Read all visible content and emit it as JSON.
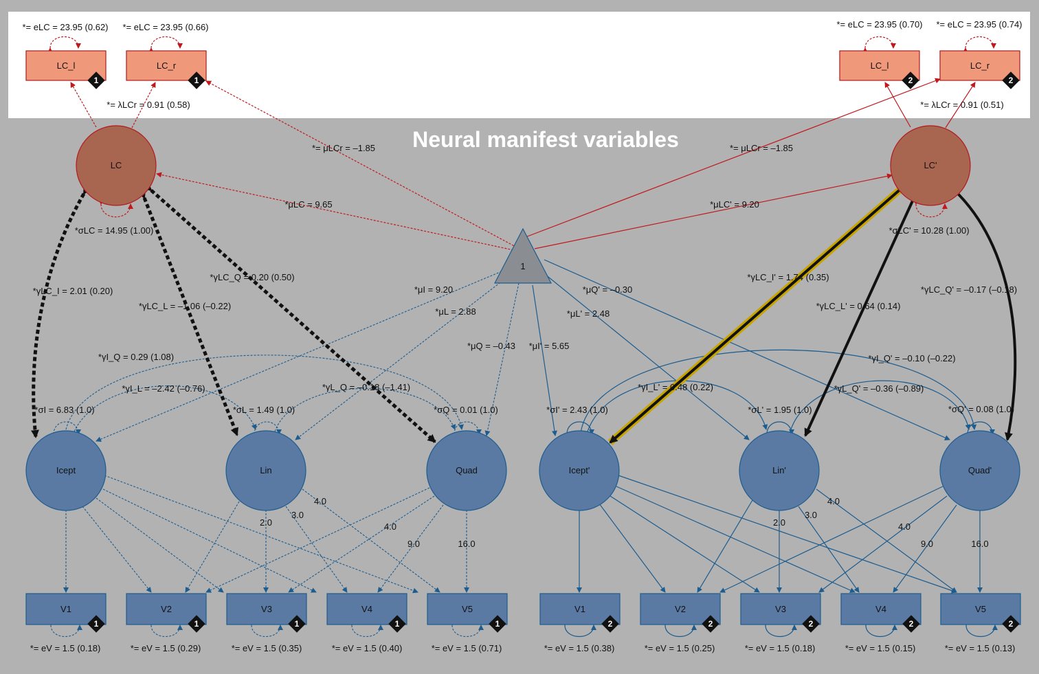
{
  "title": "Neural manifest variables",
  "colors": {
    "background": "#b2b2b2",
    "top_band": "#ffffff",
    "lc_fill": "#a8654f",
    "lc_stroke": "#b2191d",
    "lc_box": "#f0997a",
    "blue_fill": "#5a7aa3",
    "blue_stroke": "#1d5c8e",
    "red": "#c0191d",
    "dark": "#111111",
    "highlight": "#c8a400"
  },
  "nodes": {
    "lc1_l": "LC_l",
    "lc1_r": "LC_r",
    "lc2_l": "LC_l",
    "lc2_r": "LC_r",
    "lc": "LC",
    "lcp": "LC'",
    "tri": "1",
    "icept": "Icept",
    "lin": "Lin",
    "quad": "Quad",
    "iceptp": "Icept'",
    "linp": "Lin'",
    "quadp": "Quad'",
    "v1": "V1",
    "v2": "V2",
    "v3": "V3",
    "v4": "V4",
    "v5": "V5",
    "v1p": "V1",
    "v2p": "V2",
    "v3p": "V3",
    "v4p": "V4",
    "v5p": "V5"
  },
  "badges": {
    "g1": "1",
    "g2": "2"
  },
  "labels": {
    "elc1a": "*= eLC = 23.95 (0.62)",
    "elc1b": "*= eLC = 23.95 (0.66)",
    "elc2a": "*= eLC = 23.95 (0.70)",
    "elc2b": "*= eLC = 23.95 (0.74)",
    "lam1": "*= λLCr = 0.91 (0.58)",
    "lam2": "*= λLCr = 0.91 (0.51)",
    "mulcr1": "*= μLCr = –1.85",
    "mulcr2": "*= μLCr = –1.85",
    "mulc": "*μLC = 9.65",
    "mulcp": "*μLC' = 9.20",
    "siglc": "*σLC = 14.95 (1.00)",
    "siglcp": "*σLC' = 10.28 (1.00)",
    "glci": "*γLC_I = 2.01 (0.20)",
    "glcl": "*γLC_L = –1.06 (–0.22)",
    "glcq": "*γLC_Q = 0.20 (0.50)",
    "glcip": "*γLC_I' = 1.74 (0.35)",
    "glclp": "*γLC_L' = 0.64 (0.14)",
    "glcqp": "*γLC_Q' = –0.17 (–0.18)",
    "mui": "*μI = 9.20",
    "mul": "*μL = 2.88",
    "muq": "*μQ = –0.43",
    "muip": "*μI' = 5.65",
    "mulp": "*μL' = 2.48",
    "muqp": "*μQ' = –0.30",
    "giq": "*γI_Q = 0.29 (1.08)",
    "gil": "*γI_L = –2.42 (–0.76)",
    "glq": "*γL_Q = –0.18 (–1.41)",
    "giqp": "*γI_Q' = –0.10 (–0.22)",
    "gilp": "*γI_L' = 0.48 (0.22)",
    "glqp": "*γL_Q' = –0.36 (–0.89)",
    "sigi": "*σI = 6.83 (1.0)",
    "sigl": "*σL = 1.49 (1.0)",
    "sigq": "*σQ = 0.01 (1.0)",
    "sigip": "*σI' = 2.43 (1.0)",
    "siglp": "*σL' = 1.95 (1.0)",
    "sigqp": "*σQ' = 0.08 (1.0)",
    "l20": "2.0",
    "l30": "3.0",
    "l40": "4.0",
    "q40": "4.0",
    "q90": "9.0",
    "q160": "16.0",
    "l20p": "2.0",
    "l30p": "3.0",
    "l40p": "4.0",
    "q40p": "4.0",
    "q90p": "9.0",
    "q160p": "16.0",
    "ev1": "*= eV = 1.5 (0.18)",
    "ev2": "*= eV = 1.5 (0.29)",
    "ev3": "*= eV = 1.5 (0.35)",
    "ev4": "*= eV = 1.5 (0.40)",
    "ev5": "*= eV = 1.5 (0.71)",
    "ev1p": "*= eV = 1.5 (0.38)",
    "ev2p": "*= eV = 1.5 (0.25)",
    "ev3p": "*= eV = 1.5 (0.18)",
    "ev4p": "*= eV = 1.5 (0.15)",
    "ev5p": "*= eV = 1.5 (0.13)"
  }
}
